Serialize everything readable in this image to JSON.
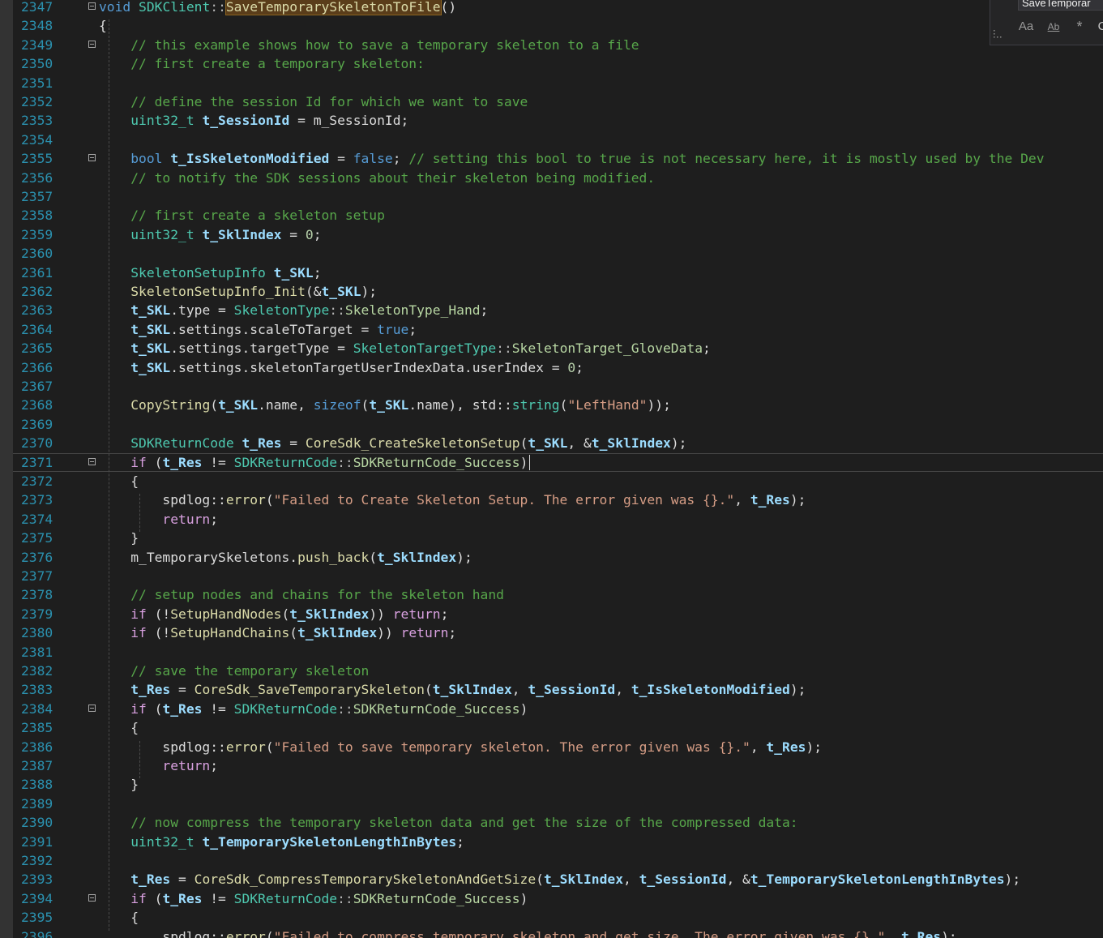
{
  "theme": {
    "background": "#1e1e1e",
    "line_number": "#2b91af",
    "comment": "#57a64a",
    "keyword": "#569cd6",
    "control": "#d8a0df",
    "type": "#4ec9b0",
    "function": "#dcdcaa",
    "variable": "#9cdcfe",
    "string": "#d69d85",
    "number": "#b5cea8",
    "highlight": "#5a3d1a"
  },
  "find_widget": {
    "search_text": "SaveTemporar",
    "case_icon_label": "Aa",
    "word_icon_label": "Ab",
    "regex_icon_label": "*",
    "more_icon_label": "C",
    "icons": [
      "grip-icon",
      "match-case-icon",
      "whole-word-icon",
      "regex-icon"
    ]
  },
  "editor": {
    "current_line": 2371,
    "lines": [
      {
        "n": "2347",
        "fold": true,
        "tokens": [
          [
            "kw",
            "void"
          ],
          [
            "def",
            " "
          ],
          [
            "type",
            "SDKClient"
          ],
          [
            "op",
            "::"
          ],
          [
            "hl",
            "SaveTemporarySkeletonToFile"
          ],
          [
            "def",
            "()"
          ]
        ]
      },
      {
        "n": "2348",
        "fold": false,
        "tokens": [
          [
            "def",
            "{"
          ]
        ]
      },
      {
        "n": "2349",
        "fold": true,
        "tokens": [
          [
            "def",
            "    "
          ],
          [
            "com",
            "// this example shows how to save a temporary skeleton to a file"
          ]
        ]
      },
      {
        "n": "2350",
        "fold": false,
        "tokens": [
          [
            "def",
            "    "
          ],
          [
            "com",
            "// first create a temporary skeleton:"
          ]
        ]
      },
      {
        "n": "2351",
        "fold": false,
        "tokens": []
      },
      {
        "n": "2352",
        "fold": false,
        "tokens": [
          [
            "def",
            "    "
          ],
          [
            "com",
            "// define the session Id for which we want to save"
          ]
        ]
      },
      {
        "n": "2353",
        "fold": false,
        "tokens": [
          [
            "def",
            "    "
          ],
          [
            "type",
            "uint32_t"
          ],
          [
            "def",
            " "
          ],
          [
            "var",
            "t_SessionId"
          ],
          [
            "def",
            " = m_SessionId;"
          ]
        ]
      },
      {
        "n": "2354",
        "fold": false,
        "tokens": []
      },
      {
        "n": "2355",
        "fold": true,
        "tokens": [
          [
            "def",
            "    "
          ],
          [
            "kw",
            "bool"
          ],
          [
            "def",
            " "
          ],
          [
            "var",
            "t_IsSkeletonModified"
          ],
          [
            "def",
            " = "
          ],
          [
            "kw",
            "false"
          ],
          [
            "def",
            "; "
          ],
          [
            "com",
            "// setting this bool to true is not necessary here, it is mostly used by the Dev"
          ]
        ]
      },
      {
        "n": "2356",
        "fold": false,
        "tokens": [
          [
            "def",
            "    "
          ],
          [
            "com",
            "// to notify the SDK sessions about their skeleton being modified."
          ]
        ]
      },
      {
        "n": "2357",
        "fold": false,
        "tokens": []
      },
      {
        "n": "2358",
        "fold": false,
        "tokens": [
          [
            "def",
            "    "
          ],
          [
            "com",
            "// first create a skeleton setup"
          ]
        ]
      },
      {
        "n": "2359",
        "fold": false,
        "tokens": [
          [
            "def",
            "    "
          ],
          [
            "type",
            "uint32_t"
          ],
          [
            "def",
            " "
          ],
          [
            "var",
            "t_SklIndex"
          ],
          [
            "def",
            " = "
          ],
          [
            "num",
            "0"
          ],
          [
            "def",
            ";"
          ]
        ]
      },
      {
        "n": "2360",
        "fold": false,
        "tokens": []
      },
      {
        "n": "2361",
        "fold": false,
        "tokens": [
          [
            "def",
            "    "
          ],
          [
            "type",
            "SkeletonSetupInfo"
          ],
          [
            "def",
            " "
          ],
          [
            "var",
            "t_SKL"
          ],
          [
            "def",
            ";"
          ]
        ]
      },
      {
        "n": "2362",
        "fold": false,
        "tokens": [
          [
            "def",
            "    "
          ],
          [
            "fn",
            "SkeletonSetupInfo_Init"
          ],
          [
            "def",
            "(&"
          ],
          [
            "var",
            "t_SKL"
          ],
          [
            "def",
            ");"
          ]
        ]
      },
      {
        "n": "2363",
        "fold": false,
        "tokens": [
          [
            "def",
            "    "
          ],
          [
            "var",
            "t_SKL"
          ],
          [
            "def",
            ".type = "
          ],
          [
            "type",
            "SkeletonType"
          ],
          [
            "op",
            "::"
          ],
          [
            "enum",
            "SkeletonType_Hand"
          ],
          [
            "def",
            ";"
          ]
        ]
      },
      {
        "n": "2364",
        "fold": false,
        "tokens": [
          [
            "def",
            "    "
          ],
          [
            "var",
            "t_SKL"
          ],
          [
            "def",
            ".settings.scaleToTarget = "
          ],
          [
            "kw",
            "true"
          ],
          [
            "def",
            ";"
          ]
        ]
      },
      {
        "n": "2365",
        "fold": false,
        "tokens": [
          [
            "def",
            "    "
          ],
          [
            "var",
            "t_SKL"
          ],
          [
            "def",
            ".settings.targetType = "
          ],
          [
            "type",
            "SkeletonTargetType"
          ],
          [
            "op",
            "::"
          ],
          [
            "enum",
            "SkeletonTarget_GloveData"
          ],
          [
            "def",
            ";"
          ]
        ]
      },
      {
        "n": "2366",
        "fold": false,
        "tokens": [
          [
            "def",
            "    "
          ],
          [
            "var",
            "t_SKL"
          ],
          [
            "def",
            ".settings.skeletonTargetUserIndexData.userIndex = "
          ],
          [
            "num",
            "0"
          ],
          [
            "def",
            ";"
          ]
        ]
      },
      {
        "n": "2367",
        "fold": false,
        "tokens": []
      },
      {
        "n": "2368",
        "fold": false,
        "tokens": [
          [
            "def",
            "    "
          ],
          [
            "fn",
            "CopyString"
          ],
          [
            "def",
            "("
          ],
          [
            "var",
            "t_SKL"
          ],
          [
            "def",
            ".name, "
          ],
          [
            "kw",
            "sizeof"
          ],
          [
            "def",
            "("
          ],
          [
            "var",
            "t_SKL"
          ],
          [
            "def",
            ".name), std::"
          ],
          [
            "type",
            "string"
          ],
          [
            "def",
            "("
          ],
          [
            "str",
            "\"LeftHand\""
          ],
          [
            "def",
            "));"
          ]
        ]
      },
      {
        "n": "2369",
        "fold": false,
        "tokens": []
      },
      {
        "n": "2370",
        "fold": false,
        "tokens": [
          [
            "def",
            "    "
          ],
          [
            "type",
            "SDKReturnCode"
          ],
          [
            "def",
            " "
          ],
          [
            "var",
            "t_Res"
          ],
          [
            "def",
            " = "
          ],
          [
            "fn",
            "CoreSdk_CreateSkeletonSetup"
          ],
          [
            "def",
            "("
          ],
          [
            "var",
            "t_SKL"
          ],
          [
            "def",
            ", &"
          ],
          [
            "var",
            "t_SklIndex"
          ],
          [
            "def",
            ");"
          ]
        ]
      },
      {
        "n": "2371",
        "fold": true,
        "tokens": [
          [
            "def",
            "    "
          ],
          [
            "ctl",
            "if"
          ],
          [
            "def",
            " ("
          ],
          [
            "var",
            "t_Res"
          ],
          [
            "def",
            " != "
          ],
          [
            "type",
            "SDKReturnCode"
          ],
          [
            "op",
            "::"
          ],
          [
            "enum",
            "SDKReturnCode_Success"
          ],
          [
            "def",
            ")"
          ]
        ]
      },
      {
        "n": "2372",
        "fold": false,
        "tokens": [
          [
            "def",
            "    {"
          ]
        ]
      },
      {
        "n": "2373",
        "fold": false,
        "tokens": [
          [
            "def",
            "        spdlog::"
          ],
          [
            "fn",
            "error"
          ],
          [
            "def",
            "("
          ],
          [
            "str",
            "\"Failed to Create Skeleton Setup. The error given was {}.\""
          ],
          [
            "def",
            ", "
          ],
          [
            "var",
            "t_Res"
          ],
          [
            "def",
            ");"
          ]
        ]
      },
      {
        "n": "2374",
        "fold": false,
        "tokens": [
          [
            "def",
            "        "
          ],
          [
            "ctl",
            "return"
          ],
          [
            "def",
            ";"
          ]
        ]
      },
      {
        "n": "2375",
        "fold": false,
        "tokens": [
          [
            "def",
            "    }"
          ]
        ]
      },
      {
        "n": "2376",
        "fold": false,
        "tokens": [
          [
            "def",
            "    m_TemporarySkeletons."
          ],
          [
            "fn",
            "push_back"
          ],
          [
            "def",
            "("
          ],
          [
            "var",
            "t_SklIndex"
          ],
          [
            "def",
            ");"
          ]
        ]
      },
      {
        "n": "2377",
        "fold": false,
        "tokens": []
      },
      {
        "n": "2378",
        "fold": false,
        "tokens": [
          [
            "def",
            "    "
          ],
          [
            "com",
            "// setup nodes and chains for the skeleton hand"
          ]
        ]
      },
      {
        "n": "2379",
        "fold": false,
        "tokens": [
          [
            "def",
            "    "
          ],
          [
            "ctl",
            "if"
          ],
          [
            "def",
            " (!"
          ],
          [
            "fn",
            "SetupHandNodes"
          ],
          [
            "def",
            "("
          ],
          [
            "var",
            "t_SklIndex"
          ],
          [
            "def",
            ")) "
          ],
          [
            "ctl",
            "return"
          ],
          [
            "def",
            ";"
          ]
        ]
      },
      {
        "n": "2380",
        "fold": false,
        "tokens": [
          [
            "def",
            "    "
          ],
          [
            "ctl",
            "if"
          ],
          [
            "def",
            " (!"
          ],
          [
            "fn",
            "SetupHandChains"
          ],
          [
            "def",
            "("
          ],
          [
            "var",
            "t_SklIndex"
          ],
          [
            "def",
            ")) "
          ],
          [
            "ctl",
            "return"
          ],
          [
            "def",
            ";"
          ]
        ]
      },
      {
        "n": "2381",
        "fold": false,
        "tokens": []
      },
      {
        "n": "2382",
        "fold": false,
        "tokens": [
          [
            "def",
            "    "
          ],
          [
            "com",
            "// save the temporary skeleton"
          ]
        ]
      },
      {
        "n": "2383",
        "fold": false,
        "tokens": [
          [
            "def",
            "    "
          ],
          [
            "var",
            "t_Res"
          ],
          [
            "def",
            " = "
          ],
          [
            "fn",
            "CoreSdk_SaveTemporarySkeleton"
          ],
          [
            "def",
            "("
          ],
          [
            "var",
            "t_SklIndex"
          ],
          [
            "def",
            ", "
          ],
          [
            "var",
            "t_SessionId"
          ],
          [
            "def",
            ", "
          ],
          [
            "var",
            "t_IsSkeletonModified"
          ],
          [
            "def",
            ");"
          ]
        ]
      },
      {
        "n": "2384",
        "fold": true,
        "tokens": [
          [
            "def",
            "    "
          ],
          [
            "ctl",
            "if"
          ],
          [
            "def",
            " ("
          ],
          [
            "var",
            "t_Res"
          ],
          [
            "def",
            " != "
          ],
          [
            "type",
            "SDKReturnCode"
          ],
          [
            "op",
            "::"
          ],
          [
            "enum",
            "SDKReturnCode_Success"
          ],
          [
            "def",
            ")"
          ]
        ]
      },
      {
        "n": "2385",
        "fold": false,
        "tokens": [
          [
            "def",
            "    {"
          ]
        ]
      },
      {
        "n": "2386",
        "fold": false,
        "tokens": [
          [
            "def",
            "        spdlog::"
          ],
          [
            "fn",
            "error"
          ],
          [
            "def",
            "("
          ],
          [
            "str",
            "\"Failed to save temporary skeleton. The error given was {}.\""
          ],
          [
            "def",
            ", "
          ],
          [
            "var",
            "t_Res"
          ],
          [
            "def",
            ");"
          ]
        ]
      },
      {
        "n": "2387",
        "fold": false,
        "tokens": [
          [
            "def",
            "        "
          ],
          [
            "ctl",
            "return"
          ],
          [
            "def",
            ";"
          ]
        ]
      },
      {
        "n": "2388",
        "fold": false,
        "tokens": [
          [
            "def",
            "    }"
          ]
        ]
      },
      {
        "n": "2389",
        "fold": false,
        "tokens": []
      },
      {
        "n": "2390",
        "fold": false,
        "tokens": [
          [
            "def",
            "    "
          ],
          [
            "com",
            "// now compress the temporary skeleton data and get the size of the compressed data:"
          ]
        ]
      },
      {
        "n": "2391",
        "fold": false,
        "tokens": [
          [
            "def",
            "    "
          ],
          [
            "type",
            "uint32_t"
          ],
          [
            "def",
            " "
          ],
          [
            "var",
            "t_TemporarySkeletonLengthInBytes"
          ],
          [
            "def",
            ";"
          ]
        ]
      },
      {
        "n": "2392",
        "fold": false,
        "tokens": []
      },
      {
        "n": "2393",
        "fold": false,
        "tokens": [
          [
            "def",
            "    "
          ],
          [
            "var",
            "t_Res"
          ],
          [
            "def",
            " = "
          ],
          [
            "fn",
            "CoreSdk_CompressTemporarySkeletonAndGetSize"
          ],
          [
            "def",
            "("
          ],
          [
            "var",
            "t_SklIndex"
          ],
          [
            "def",
            ", "
          ],
          [
            "var",
            "t_SessionId"
          ],
          [
            "def",
            ", &"
          ],
          [
            "var",
            "t_TemporarySkeletonLengthInBytes"
          ],
          [
            "def",
            ");"
          ]
        ]
      },
      {
        "n": "2394",
        "fold": true,
        "tokens": [
          [
            "def",
            "    "
          ],
          [
            "ctl",
            "if"
          ],
          [
            "def",
            " ("
          ],
          [
            "var",
            "t_Res"
          ],
          [
            "def",
            " != "
          ],
          [
            "type",
            "SDKReturnCode"
          ],
          [
            "op",
            "::"
          ],
          [
            "enum",
            "SDKReturnCode_Success"
          ],
          [
            "def",
            ")"
          ]
        ]
      },
      {
        "n": "2395",
        "fold": false,
        "tokens": [
          [
            "def",
            "    {"
          ]
        ]
      },
      {
        "n": "2396",
        "fold": false,
        "tokens": [
          [
            "def",
            "        spdlog::"
          ],
          [
            "fn",
            "error"
          ],
          [
            "def",
            "("
          ],
          [
            "str",
            "\"Failed to compress temporary skeleton and get size. The error given was {}.\""
          ],
          [
            "def",
            ", "
          ],
          [
            "var",
            "t_Res"
          ],
          [
            "def",
            ");"
          ]
        ]
      }
    ]
  }
}
